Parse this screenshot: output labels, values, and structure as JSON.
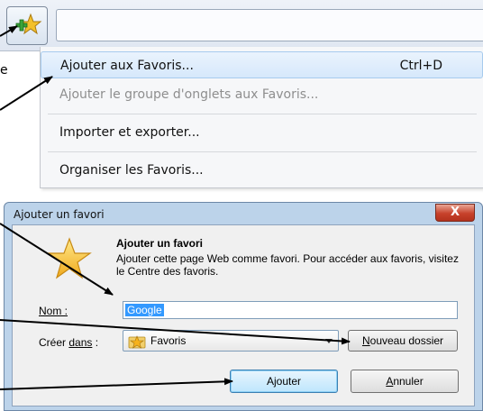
{
  "toolbar": {
    "add_favorites_icon": "star-plus-icon",
    "address": ""
  },
  "edge_text": "e",
  "menu": {
    "items": [
      {
        "label": "Ajouter aux Favoris...",
        "shortcut": "Ctrl+D",
        "state": "highlighted"
      },
      {
        "label": "Ajouter le groupe d'onglets aux Favoris...",
        "state": "disabled"
      },
      {
        "label": "Importer et exporter...",
        "state": "normal"
      },
      {
        "label": "Organiser les Favoris...",
        "state": "normal"
      }
    ]
  },
  "dialog": {
    "title": "Ajouter un favori",
    "close_glyph": "X",
    "heading": "Ajouter un favori",
    "description": "Ajouter cette page Web comme favori. Pour accéder aux favoris, visitez le Centre des favoris.",
    "name_label": "Nom :",
    "name_value": "Google",
    "create_in_label_prefix": "Créer ",
    "create_in_label_underlined": "dans",
    "create_in_label_suffix": " :",
    "folder_value": "Favoris",
    "new_folder_button_underlined": "N",
    "new_folder_button_rest": "ouveau dossier",
    "add_button": "Ajouter",
    "cancel_button_underlined": "A",
    "cancel_button_rest": "nnuler"
  },
  "colors": {
    "dialog_frame": "#bcd3ea",
    "highlight": "#d6e8fb",
    "close_button": "#c7412b",
    "selection": "#3399ff"
  }
}
